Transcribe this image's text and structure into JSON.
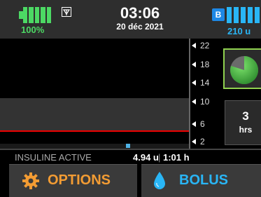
{
  "header": {
    "battery_percent": "100%",
    "battery_level": 1.0,
    "time": "03:06",
    "date": "20 déc 2021",
    "badge": "B",
    "insulin_units": "210 u",
    "insulin_level": 1.0
  },
  "graph": {
    "ticks": [
      "22",
      "18",
      "14",
      "10",
      "6",
      "2"
    ]
  },
  "iob_widget": {
    "remaining_fraction": 0.8,
    "icon": "iob-pie-icon"
  },
  "hours_button": {
    "value": "3",
    "unit": "hrs"
  },
  "status": {
    "iob_label": "INSULINE ACTIVE",
    "iob_units": "4.94 u",
    "separator": "|",
    "iob_time": "1:01 h"
  },
  "buttons": {
    "options_label": "OPTIONS",
    "bolus_label": "BOLUS"
  },
  "colors": {
    "battery": "#4cd964",
    "insulin": "#29b6f6",
    "options": "#f39c33",
    "target_line": "#ee0000",
    "iob_border": "#8fd14f"
  }
}
